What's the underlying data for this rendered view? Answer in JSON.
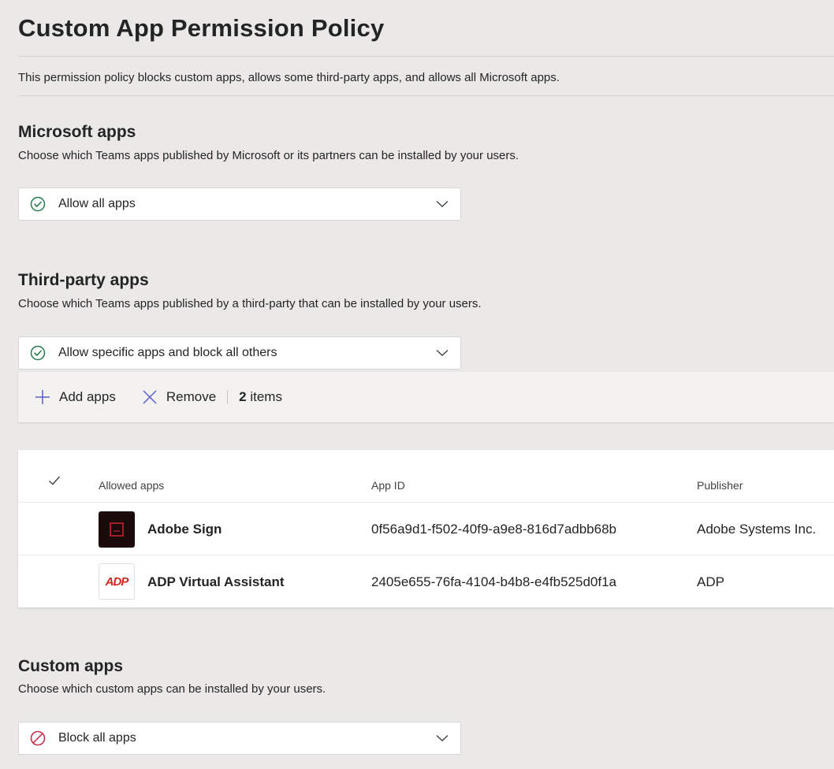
{
  "page": {
    "title": "Custom App Permission Policy",
    "description": "This permission policy blocks custom apps, allows some third-party apps, and allows all Microsoft apps."
  },
  "microsoft_apps": {
    "title": "Microsoft apps",
    "subtitle": "Choose which Teams apps published by Microsoft or its partners can be installed by your users.",
    "selected": "Allow all apps",
    "icon": "check-circle-icon"
  },
  "third_party_apps": {
    "title": "Third-party apps",
    "subtitle": "Choose which Teams apps published by a third-party that can be installed by your users.",
    "selected": "Allow specific apps and block all others",
    "icon": "check-circle-icon",
    "toolbar": {
      "add_label": "Add apps",
      "remove_label": "Remove",
      "count_number": "2",
      "count_suffix": " items"
    },
    "table": {
      "headers": [
        "Allowed apps",
        "App ID",
        "Publisher"
      ],
      "rows": [
        {
          "name": "Adobe Sign",
          "app_id": "0f56a9d1-f502-40f9-a9e8-816d7adbb68b",
          "publisher": "Adobe Systems Inc.",
          "logo_icon": "adobe-sign-logo"
        },
        {
          "name": "ADP Virtual Assistant",
          "app_id": "2405e655-76fa-4104-b4b8-e4fb525d0f1a",
          "publisher": "ADP",
          "logo_icon": "adp-logo",
          "logo_text": "ADP"
        }
      ]
    }
  },
  "custom_apps": {
    "title": "Custom apps",
    "subtitle": "Choose which custom apps can be installed by your users.",
    "selected": "Block all apps",
    "icon": "block-circle-icon"
  },
  "colors": {
    "accent_purple": "#5b5fc7",
    "allow_green": "#237b4b",
    "block_red": "#c4314b",
    "adp_red": "#d0271d",
    "adobe_dark": "#1b0a0a"
  }
}
